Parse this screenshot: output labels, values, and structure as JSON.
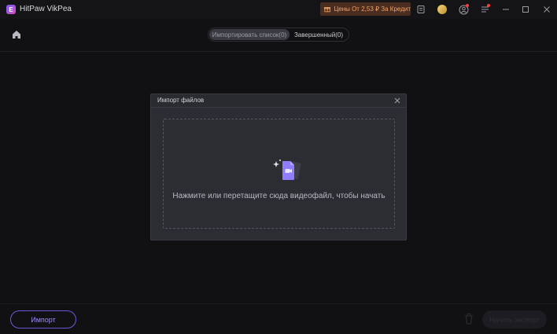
{
  "titlebar": {
    "app_title": "HitPaw VikPea",
    "logo_letter": "E",
    "promo_text": "Цены От 2,53 ₽ За Кредит"
  },
  "topbar": {
    "tabs": [
      {
        "label": "Импортировать список(0)",
        "active": true
      },
      {
        "label": "Завершенный(0)",
        "active": false
      }
    ]
  },
  "dialog": {
    "title": "Импорт файлов",
    "drop_text": "Нажмите или перетащите сюда видеофайл, чтобы начать"
  },
  "bottombar": {
    "import_label": "Импорт",
    "start_label": "Начать экспорт"
  },
  "colors": {
    "accent": "#6a5ad6",
    "promo_text": "#f0a36a",
    "promo_bg": "#4a2d1f",
    "dialog_bg": "#2c2c33",
    "background": "#111114"
  }
}
